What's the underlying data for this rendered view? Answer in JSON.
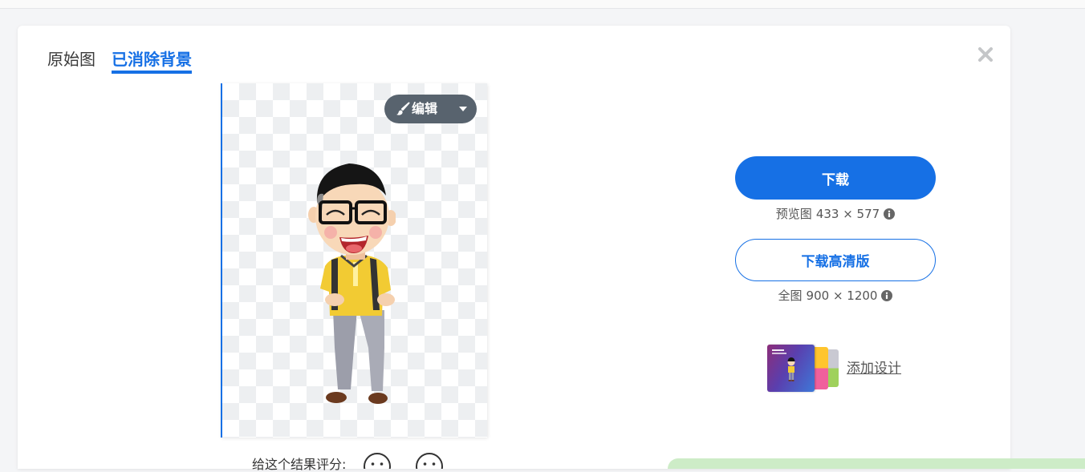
{
  "colors": {
    "accent": "#1670e5",
    "edit_button": "#58636e",
    "toast": "#cdecc7",
    "page_background": "#f4f5f7",
    "text": "#333333",
    "muted_text": "#555555"
  },
  "icons": {
    "close": "close-icon",
    "brush": "brush-icon",
    "caret": "caret-down-icon",
    "info": "info-icon",
    "rating": [
      "neutral-face-icon",
      "neutral-face-icon"
    ]
  },
  "tabs": [
    {
      "label": "原始图",
      "active": false
    },
    {
      "label": "已消除背景",
      "active": true
    }
  ],
  "editor": {
    "edit_label": "编辑"
  },
  "download": {
    "button_label": "下载",
    "preview_size": {
      "label": "预览图",
      "dimensions": "433 × 577"
    },
    "hd_button_label": "下载高清版",
    "full_size": {
      "label": "全图",
      "dimensions": "900 × 1200"
    }
  },
  "design": {
    "link_label": "添加设计"
  },
  "rating": {
    "label": "给这个结果评分:"
  }
}
